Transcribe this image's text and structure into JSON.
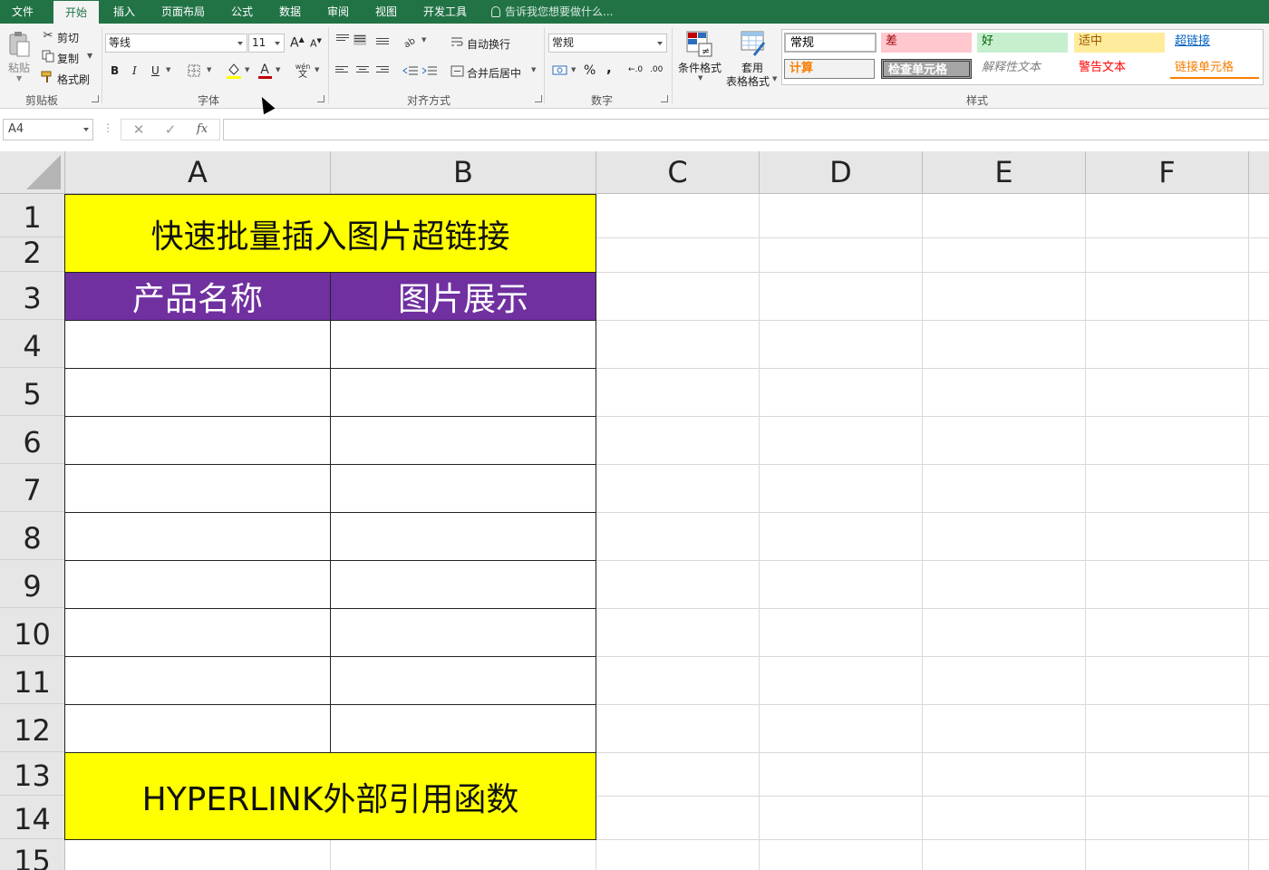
{
  "tabs": [
    "文件",
    "开始",
    "插入",
    "页面布局",
    "公式",
    "数据",
    "审阅",
    "视图",
    "开发工具"
  ],
  "active_tab": "开始",
  "tell_me": "告诉我您想要做什么...",
  "clipboard": {
    "paste": "粘贴",
    "cut": "剪切",
    "copy": "复制",
    "format_painter": "格式刷",
    "group_label": "剪贴板"
  },
  "font": {
    "family": "等线",
    "size": "11",
    "bold": "B",
    "italic": "I",
    "underline": "U",
    "grow": "A",
    "shrink": "A",
    "font_color_letter": "A",
    "phonetic": "wén",
    "phonetic_char": "文",
    "group_label": "字体"
  },
  "alignment": {
    "wrap_text": "自动换行",
    "merge_center": "合并后居中",
    "group_label": "对齐方式"
  },
  "number": {
    "format": "常规",
    "percent": "%",
    "comma": ",",
    "inc_decimal": "←.0",
    "dec_decimal": ".00",
    "group_label": "数字"
  },
  "styles": {
    "conditional_format": "条件格式",
    "format_as_table_1": "套用",
    "format_as_table_2": "表格格式",
    "group_label": "样式",
    "gallery": [
      {
        "label": "常规",
        "color": "#000000",
        "bg": "#ffffff"
      },
      {
        "label": "差",
        "color": "#9c0006",
        "bg": "#ffc7ce"
      },
      {
        "label": "好",
        "color": "#006100",
        "bg": "#c6efce"
      },
      {
        "label": "适中",
        "color": "#9c5700",
        "bg": "#ffeb9c"
      },
      {
        "label": "超链接",
        "color": "#0563c1",
        "bg": "#ffffff"
      },
      {
        "label": "计算",
        "color": "#fa7d00",
        "bg": "#f2f2f2"
      },
      {
        "label": "检查单元格",
        "color": "#ffffff",
        "bg": "#a5a5a5"
      },
      {
        "label": "解释性文本",
        "color": "#7f7f7f",
        "bg": "#ffffff"
      },
      {
        "label": "警告文本",
        "color": "#ff0000",
        "bg": "#ffffff"
      },
      {
        "label": "链接单元格",
        "color": "#fa7d00",
        "bg": "#ffffff"
      }
    ]
  },
  "formula_bar": {
    "name_box": "A4",
    "cancel": "✕",
    "enter": "✓",
    "fx": "fx",
    "value": ""
  },
  "columns": [
    "A",
    "B",
    "C",
    "D",
    "E",
    "F"
  ],
  "rows": [
    "1",
    "2",
    "3",
    "4",
    "5",
    "6",
    "7",
    "8",
    "9",
    "10",
    "11",
    "12",
    "13",
    "14",
    "15"
  ],
  "sheet": {
    "title": "快速批量插入图片超链接",
    "header_a": "产品名称",
    "header_b": "图片展示",
    "footer": "HYPERLINK外部引用函数"
  },
  "colors": {
    "accent": "#217346",
    "title_fill": "#ffff00",
    "header_fill": "#7030a0"
  }
}
